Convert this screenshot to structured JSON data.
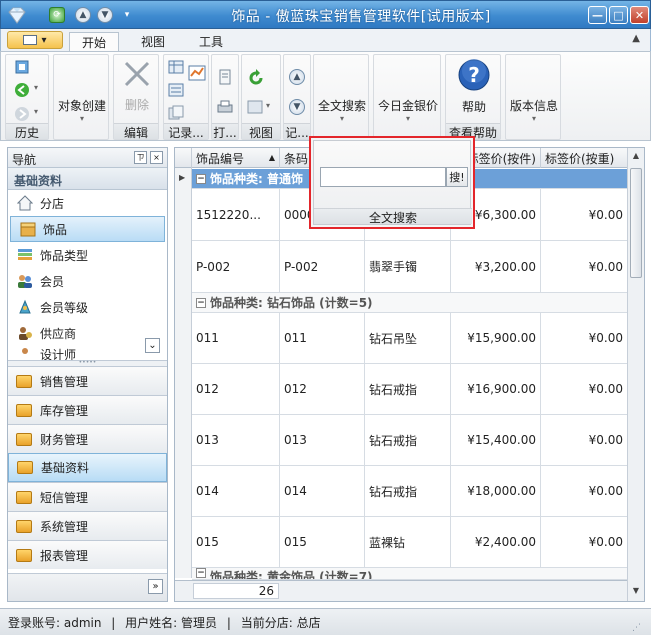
{
  "window": {
    "title": "饰品 - 傲蓝珠宝销售管理软件[试用版本]"
  },
  "ribbon": {
    "tabs": [
      "开始",
      "视图",
      "工具"
    ],
    "groups": {
      "history": "历史",
      "object_create": "对象创建",
      "delete": "删除",
      "edit": "编辑",
      "record": "记录...",
      "print": "打...",
      "view": "视图",
      "record2": "记...",
      "fulltext": "全文搜索",
      "gold_price": "今日金银价",
      "help": "帮助",
      "view_help": "查看帮助",
      "version": "版本信息"
    }
  },
  "popup": {
    "placeholder": "",
    "search_btn": "搜!",
    "label": "全文搜索"
  },
  "nav": {
    "header": "导航",
    "section": "基础资料",
    "items": [
      "分店",
      "饰品",
      "饰品类型",
      "会员",
      "会员等级",
      "供应商",
      "设计师"
    ],
    "groups": [
      "销售管理",
      "库存管理",
      "财务管理",
      "基础资料",
      "短信管理",
      "系统管理",
      "报表管理"
    ]
  },
  "grid": {
    "columns": [
      "饰品编号",
      "条码",
      "",
      "",
      "标签价(按件)",
      "标签价(按重)"
    ],
    "group1": "饰品种类: 普通饰",
    "group2": "饰品种类: 钻石饰品 (计数=5)",
    "group3": "饰品种类: 黄金饰品 (计数=7)",
    "rows_g1": [
      {
        "id": "1512220...",
        "code": "0000",
        "name": "",
        "price": "¥6,300.00",
        "wprice": "¥0.00"
      },
      {
        "id": "P-002",
        "code": "P-002",
        "name": "翡翠手镯",
        "price": "¥3,200.00",
        "wprice": "¥0.00"
      }
    ],
    "rows_g2": [
      {
        "id": "011",
        "code": "011",
        "name": "钻石吊坠",
        "price": "¥15,900.00",
        "wprice": "¥0.00"
      },
      {
        "id": "012",
        "code": "012",
        "name": "钻石戒指",
        "price": "¥16,900.00",
        "wprice": "¥0.00"
      },
      {
        "id": "013",
        "code": "013",
        "name": "钻石戒指",
        "price": "¥15,400.00",
        "wprice": "¥0.00"
      },
      {
        "id": "014",
        "code": "014",
        "name": "钻石戒指",
        "price": "¥18,000.00",
        "wprice": "¥0.00"
      },
      {
        "id": "015",
        "code": "015",
        "name": "蓝裸钻",
        "price": "¥2,400.00",
        "wprice": "¥0.00"
      }
    ],
    "count": "26"
  },
  "status": {
    "account": "登录账号: admin",
    "user": "用户姓名: 管理员",
    "branch": "当前分店: 总店",
    "sep": "|"
  }
}
